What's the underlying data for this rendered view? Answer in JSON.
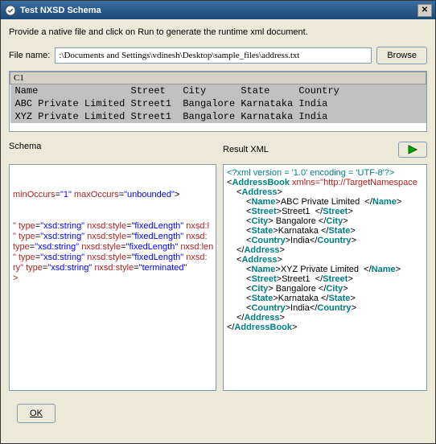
{
  "title": "Test NXSD Schema",
  "instruction": "Provide a native file and click on Run to generate the runtime xml document.",
  "file_label": "File name:",
  "file_value": ":\\Documents and Settings\\vdinesh\\Desktop\\sample_files\\address.txt",
  "browse_label": "Browse",
  "preview": {
    "col_header": "C1",
    "headers": [
      "Name",
      "Street",
      "City",
      "State",
      "Country"
    ],
    "rows": [
      [
        "ABC Private Limited",
        "Street1",
        "Bangalore",
        "Karnataka",
        "India"
      ],
      [
        "XYZ Private Limited",
        "Street1",
        "Bangalore",
        "Karnataka",
        "India"
      ]
    ]
  },
  "schema_label": "Schema",
  "result_label": "Result XML",
  "schema_lines": [
    {
      "text": ""
    },
    {
      "text": ""
    },
    {
      "html": "<span class='attrname'>minOccurs</span>=<span class='attrval'>\"1\"</span> <span class='attrname'>maxOccurs</span>=<span class='attrval'>\"unbounded\"</span>&gt;"
    },
    {
      "text": ""
    },
    {
      "text": ""
    },
    {
      "html": "<span class='plain'>\" </span><span class='attrname'>type</span>=<span class='attrval'>\"xsd:string\"</span> <span class='attrname'>nxsd:style</span>=<span class='attrval'>\"fixedLength\"</span> <span class='attrname'>nxsd:l</span>"
    },
    {
      "html": "<span class='plain'>\" </span><span class='attrname'>type</span>=<span class='attrval'>\"xsd:string\"</span> <span class='attrname'>nxsd:style</span>=<span class='attrval'>\"fixedLength\"</span> <span class='attrname'>nxsd:</span>"
    },
    {
      "html": "<span class='attrname'>type</span>=<span class='attrval'>\"xsd:string\"</span> <span class='attrname'>nxsd:style</span>=<span class='attrval'>\"fixedLength\"</span> <span class='attrname'>nxsd:len</span>"
    },
    {
      "html": "<span class='plain'>\" </span><span class='attrname'>type</span>=<span class='attrval'>\"xsd:string\"</span> <span class='attrname'>nxsd:style</span>=<span class='attrval'>\"fixedLength\"</span> <span class='attrname'>nxsd:</span>"
    },
    {
      "html": "<span class='plain'>ry\" </span><span class='attrname'>type</span>=<span class='attrval'>\"xsd:string\"</span> <span class='attrname'>nxsd:style</span>=<span class='attrval'>\"terminated\"</span>"
    },
    {
      "html": "<span class='plain'>&gt;</span>"
    }
  ],
  "result_xml": {
    "pi": "<?xml version = '1.0' encoding = 'UTF-8'?>",
    "root_open": "AddressBook",
    "root_ns": "xmlns=\"http://TargetNamespace",
    "addresses": [
      {
        "Name": "ABC Private Limited",
        "Street": "Street1",
        "City": "Bangalore",
        "State": "Karnataka",
        "Country": "India"
      },
      {
        "Name": "XYZ Private Limited",
        "Street": "Street1",
        "City": "Bangalore",
        "State": "Karnataka",
        "Country": "India"
      }
    ]
  },
  "ok_label": "OK"
}
